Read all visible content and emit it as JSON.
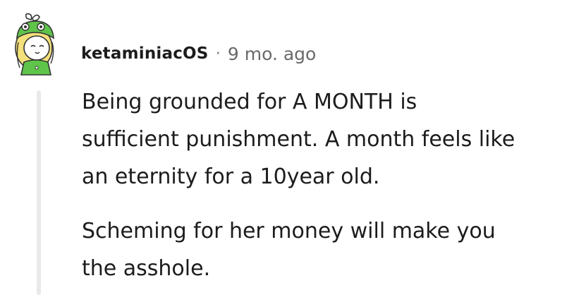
{
  "comment": {
    "author": "ketaminiacOS",
    "separator": "·",
    "age": "9 mo. ago",
    "paragraphs": [
      {
        "lines": [
          "Being grounded for A MONTH is",
          "sufficient punishment. A month feels like",
          "an eternity for a 10year old."
        ]
      },
      {
        "lines": [
          "Scheming for her money will make you",
          "the asshole."
        ]
      }
    ],
    "avatar_icon": "frog-hat-girl-avatar-icon"
  },
  "colors": {
    "text": "#1c1c1c",
    "meta": "#6a6a6a",
    "thread_line": "#e9e9e9",
    "avatar_green": "#5fc44a"
  }
}
